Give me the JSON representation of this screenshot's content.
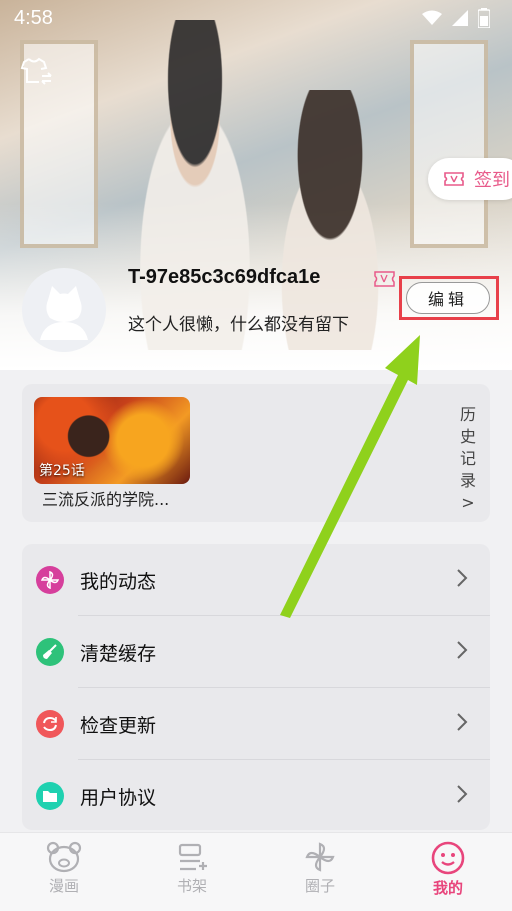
{
  "status_bar": {
    "time": "4:58"
  },
  "header": {
    "checkin_label": "签到"
  },
  "profile": {
    "username": "T-97e85c3c69dfca1e",
    "bio": "这个人很懒，什么都没有留下",
    "edit_label": "编辑"
  },
  "history": {
    "chapter": "第25话",
    "comic_title": "三流反派的学院...",
    "link_label": "历史记录",
    "link_chevron": ">"
  },
  "menu": {
    "items": [
      {
        "label": "我的动态",
        "icon": "pinwheel-icon",
        "color": "#d63f9c"
      },
      {
        "label": "清楚缓存",
        "icon": "broom-icon",
        "color": "#2ec27a"
      },
      {
        "label": "检查更新",
        "icon": "refresh-icon",
        "color": "#f0575a"
      },
      {
        "label": "用户协议",
        "icon": "folder-icon",
        "color": "#1fd1b0"
      }
    ]
  },
  "bottom_nav": {
    "items": [
      {
        "label": "漫画",
        "icon": "bear-icon"
      },
      {
        "label": "书架",
        "icon": "bookshelf-icon"
      },
      {
        "label": "圈子",
        "icon": "pinwheel-icon"
      },
      {
        "label": "我的",
        "icon": "smiley-icon",
        "active": true
      }
    ]
  },
  "colors": {
    "accent": "#e8457c",
    "highlight_box": "#e8404a",
    "arrow": "#8fd11c"
  }
}
